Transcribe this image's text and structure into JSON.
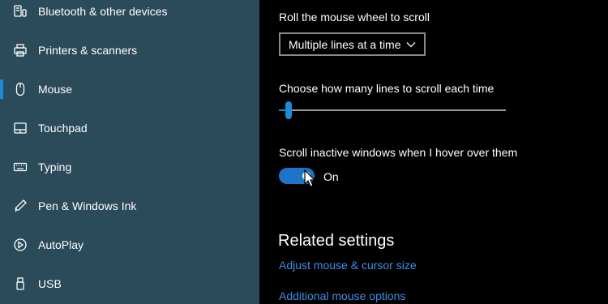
{
  "sidebar": {
    "items": [
      {
        "label": "Bluetooth & other devices",
        "icon": "bluetooth-devices-icon",
        "selected": false
      },
      {
        "label": "Printers & scanners",
        "icon": "printer-icon",
        "selected": false
      },
      {
        "label": "Mouse",
        "icon": "mouse-icon",
        "selected": true
      },
      {
        "label": "Touchpad",
        "icon": "touchpad-icon",
        "selected": false
      },
      {
        "label": "Typing",
        "icon": "keyboard-icon",
        "selected": false
      },
      {
        "label": "Pen & Windows Ink",
        "icon": "pen-icon",
        "selected": false
      },
      {
        "label": "AutoPlay",
        "icon": "autoplay-icon",
        "selected": false
      },
      {
        "label": "USB",
        "icon": "usb-icon",
        "selected": false
      }
    ]
  },
  "settings": {
    "scroll_wheel_label": "Roll the mouse wheel to scroll",
    "scroll_wheel_value": "Multiple lines at a time",
    "lines_label": "Choose how many lines to scroll each time",
    "lines_slider_fraction": 0.03,
    "inactive_label": "Scroll inactive windows when I hover over them",
    "inactive_toggle_on": true,
    "inactive_state_text": "On"
  },
  "related": {
    "heading": "Related settings",
    "links": [
      "Adjust mouse & cursor size",
      "Additional mouse options"
    ]
  },
  "colors": {
    "sidebar_bg": "#2b4a5a",
    "accent": "#1f8ad6",
    "toggle_on": "#1f74c9",
    "link": "#3f8ee6",
    "main_bg": "#000000"
  }
}
